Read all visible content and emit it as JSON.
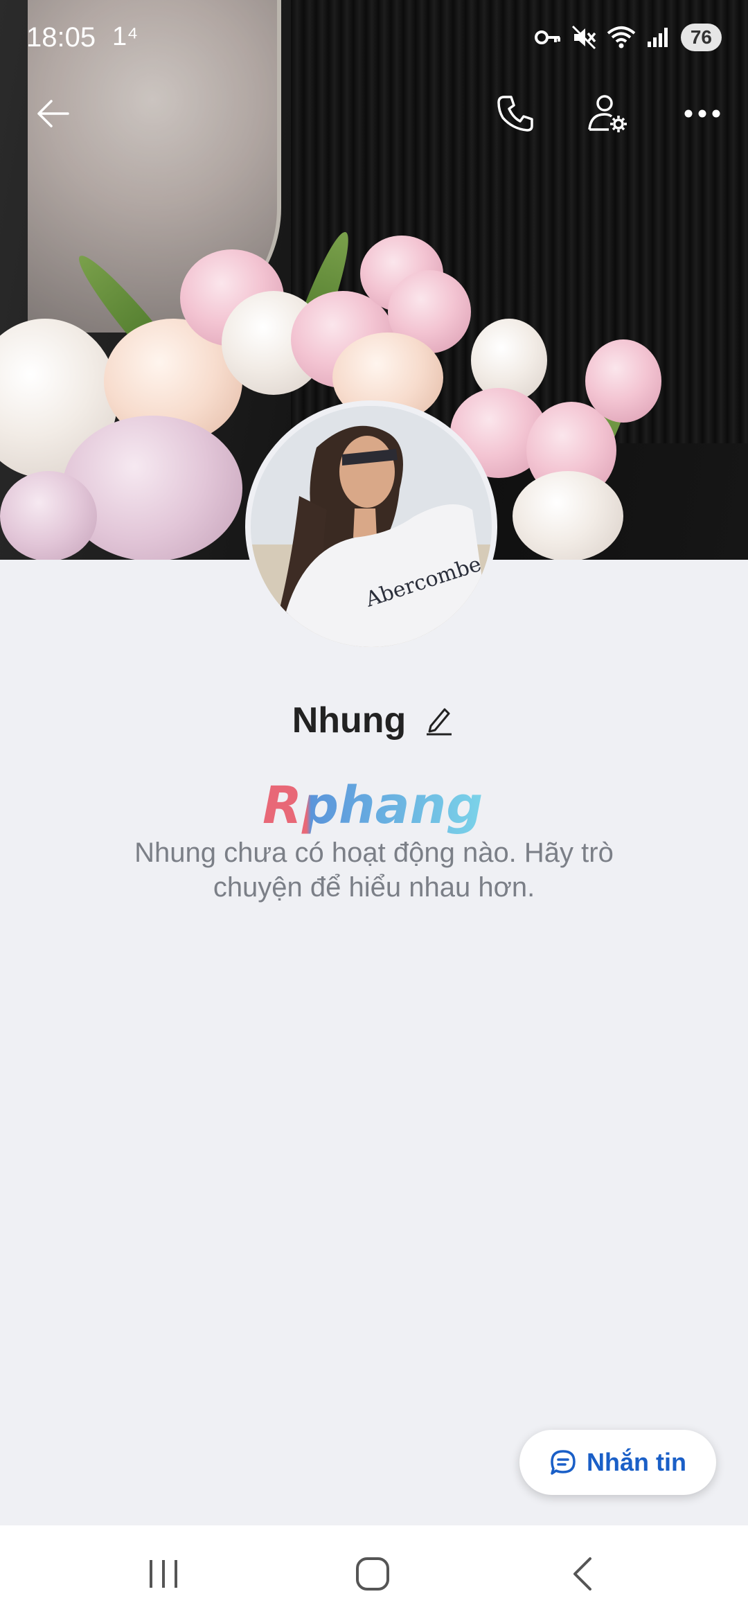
{
  "status_bar": {
    "time": "18:05",
    "network_indicator": "1⁴",
    "battery_level": "76",
    "icons": [
      "key-icon",
      "mute-icon",
      "wifi-icon",
      "signal-icon",
      "battery-icon"
    ]
  },
  "top_bar": {
    "icons": [
      "back-arrow-icon",
      "phone-icon",
      "user-settings-icon",
      "more-icon"
    ]
  },
  "profile": {
    "name": "Nhung",
    "edit_icon": "pencil-icon",
    "empty_message": "Nhung chưa có hoạt động nào. Hãy trò chuyện để hiểu nhau hơn."
  },
  "watermark": {
    "text": "Rphang"
  },
  "message_button": {
    "label": "Nhắn tin",
    "icon": "chat-bubble-icon"
  },
  "nav_bar": {
    "icons": [
      "recents-icon",
      "home-icon",
      "back-icon"
    ]
  },
  "colors": {
    "background": "#eff0f4",
    "accent": "#1a5fc7",
    "name_text": "#222222",
    "empty_text": "#7b7f87"
  }
}
